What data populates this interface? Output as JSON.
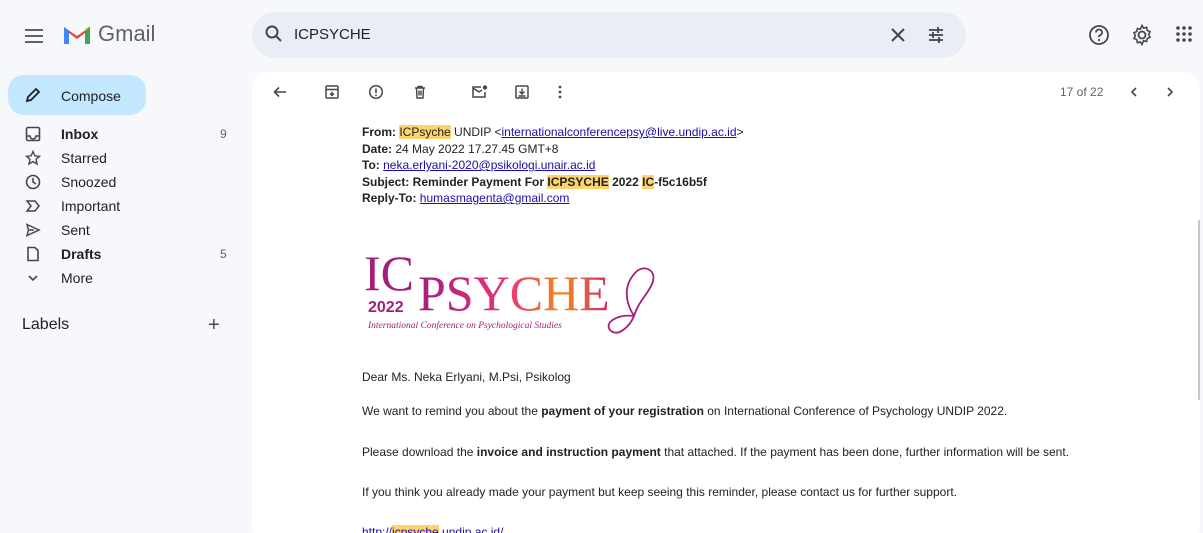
{
  "app": {
    "name": "Gmail"
  },
  "search": {
    "query": "ICPSYCHE"
  },
  "sidebar": {
    "compose_label": "Compose",
    "items": [
      {
        "label": "Inbox",
        "count": "9",
        "icon": "inbox-icon",
        "bold": true
      },
      {
        "label": "Starred",
        "count": "",
        "icon": "star-icon",
        "bold": false
      },
      {
        "label": "Snoozed",
        "count": "",
        "icon": "clock-icon",
        "bold": false
      },
      {
        "label": "Important",
        "count": "",
        "icon": "important-icon",
        "bold": false
      },
      {
        "label": "Sent",
        "count": "",
        "icon": "send-icon",
        "bold": false
      },
      {
        "label": "Drafts",
        "count": "5",
        "icon": "draft-icon",
        "bold": true
      },
      {
        "label": "More",
        "count": "",
        "icon": "chevron-down-icon",
        "bold": false
      }
    ],
    "labels_heading": "Labels",
    "labels_add": "+"
  },
  "toolbar": {
    "pager": "17 of 22"
  },
  "email": {
    "from_label": "From:",
    "from_name_hl": "ICPsyche",
    "from_name_rest": " UNDIP <",
    "from_email": "internationalconferencepsy@live.undip.ac.id",
    "from_close": ">",
    "date_label": "Date:",
    "date_value": " 24 May 2022 17.27.45 GMT+8",
    "to_label": "To:",
    "to_email": "neka.erlyani-2020@psikologi.unair.ac.id",
    "subject_label": "Subject:",
    "subject_part1": " Reminder Payment For ",
    "subject_hl1": "ICPSYCHE",
    "subject_part2": " 2022 ",
    "subject_hl2": "IC",
    "subject_part3": "-f5c16b5f",
    "replyto_label": "Reply-To:",
    "replyto_email": "humasmagenta@gmail.com",
    "logo": {
      "ic": "IC",
      "psyche": "PSYCHE",
      "year": "2022",
      "tagline": "International Conference on Psychological Studies"
    },
    "greeting": "Dear Ms. Neka Erlyani, M.Psi, Psikolog",
    "p1_a": "We want to remind you about the ",
    "p1_b": "payment of your registration",
    "p1_c": " on International Conference of Psychology UNDIP 2022.",
    "p2_a": "Please download the ",
    "p2_b": "invoice and instruction payment",
    "p2_c": " that attached. If the payment has been done, further information will be sent.",
    "p3": "If you think you already made your payment but keep seeing this reminder, please contact us for further support.",
    "url_a": "http://",
    "url_hl": "icpsyche",
    "url_c": ".undip.ac.id/"
  },
  "colors": {
    "compose_bg": "#c2e7ff",
    "search_bg": "#e9eef6",
    "highlight": "#fcd36c",
    "logo_magenta": "#a3207a",
    "logo_orange": "#f08a1c"
  }
}
